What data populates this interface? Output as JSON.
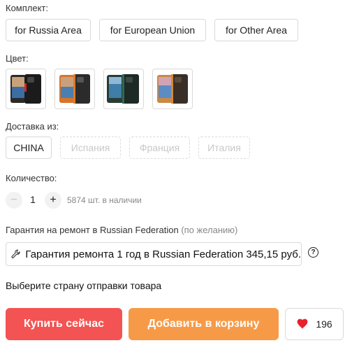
{
  "kit": {
    "label": "Комплект:",
    "options": [
      "for Russia Area",
      "for European Union",
      "for Other Area"
    ]
  },
  "color": {
    "label": "Цвет:",
    "swatches": [
      {
        "name": "black phone",
        "accent": "#222222"
      },
      {
        "name": "orange phone",
        "accent": "#e07a2a"
      },
      {
        "name": "green phone",
        "accent": "#2f6a52"
      },
      {
        "name": "orange-gold phone",
        "accent": "#d48a3a"
      }
    ]
  },
  "shipping": {
    "label": "Доставка из:",
    "options": [
      {
        "label": "CHINA",
        "available": true
      },
      {
        "label": "Испания",
        "available": false
      },
      {
        "label": "Франция",
        "available": false
      },
      {
        "label": "Италия",
        "available": false
      }
    ]
  },
  "quantity": {
    "label": "Количество:",
    "minus": "−",
    "value": "1",
    "plus": "+",
    "stock": "5874 шт. в наличии"
  },
  "warranty": {
    "label": "Гарантия на ремонт в Russian Federation",
    "optional": "(по желанию)",
    "option_text": "Гарантия ремонта 1 год в Russian Federation 345,15 руб.",
    "help": "?"
  },
  "prompt": "Выберите страну отправки товара",
  "actions": {
    "buy_now": "Купить сейчас",
    "add_to_cart": "Добавить в корзину",
    "wishlist_count": "196"
  },
  "colors": {
    "buy": "#f35352",
    "cart": "#f79a47",
    "heart": "#e8212d"
  }
}
